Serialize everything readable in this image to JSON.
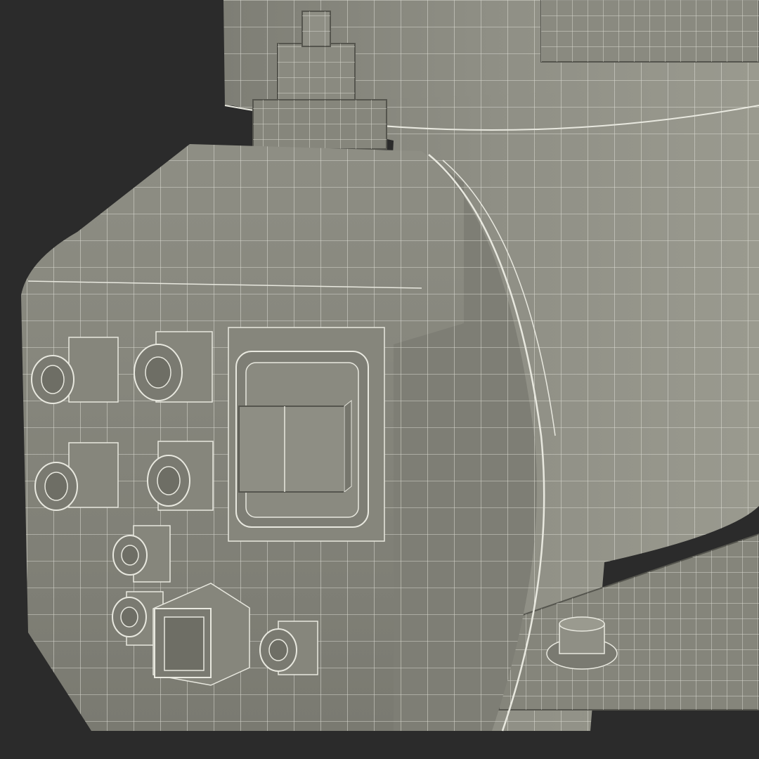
{
  "scene": {
    "subject": "compressor-wireframe-render",
    "colors": {
      "background": "#2b2b2b",
      "surface": "#8a8a80",
      "surface_light": "#a3a398",
      "surface_dark": "#6e6e65",
      "wire": "#e8e8df",
      "edge": "#55554e"
    },
    "icons": {
      "fittings": "cylindrical-fitting-icon",
      "switch": "rocker-switch-icon",
      "port": "square-port-icon",
      "bolt": "bolt-icon"
    }
  }
}
